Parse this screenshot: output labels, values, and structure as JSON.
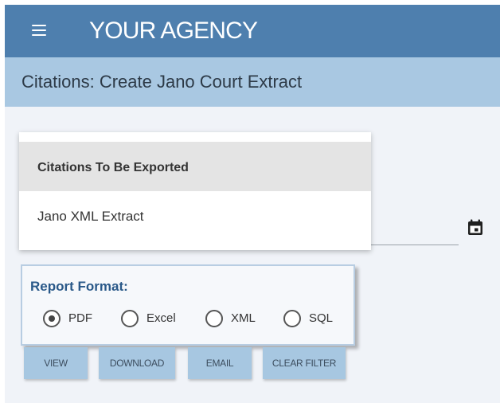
{
  "app": {
    "title": "YOUR AGENCY",
    "menu_icon": "hamburger-menu-icon"
  },
  "page": {
    "title": "Citations: Create Jano Court Extract"
  },
  "date_field": {
    "icon": "calendar-icon"
  },
  "dropdown": {
    "header": "Citations To Be Exported",
    "items": [
      "Jano XML Extract"
    ]
  },
  "report_format": {
    "title": "Report Format:",
    "options": [
      "PDF",
      "Excel",
      "XML",
      "SQL"
    ],
    "selected": "PDF"
  },
  "actions": {
    "view": "VIEW",
    "download": "DOWNLOAD",
    "email": "EMAIL",
    "clear_filter": "CLEAR FILTER"
  },
  "colors": {
    "topbar": "#4e7fae",
    "subheader": "#a9c8e2",
    "button": "#a7c7e1",
    "format_title": "#2a5989"
  }
}
